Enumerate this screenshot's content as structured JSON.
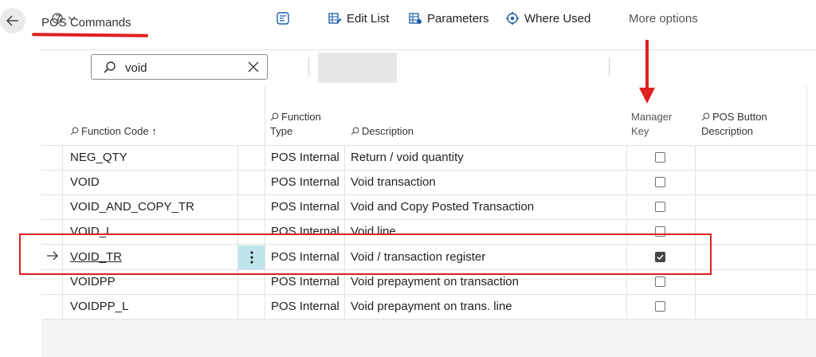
{
  "header": {
    "title": "POS Commands"
  },
  "search": {
    "value": "void"
  },
  "toolbar": {
    "edit_list": "Edit List",
    "parameters": "Parameters",
    "where_used": "Where Used",
    "more_options": "More options"
  },
  "columns": {
    "function_code": "Function Code ↑",
    "function_type_line1": "Function",
    "function_type_line2": "Type",
    "description": "Description",
    "manager_key_line1": "Manager",
    "manager_key_line2": "Key",
    "pos_button_line1": "POS Button",
    "pos_button_line2": "Description"
  },
  "rows": [
    {
      "code": "NEG_QTY",
      "type": "POS Internal",
      "description": "Return / void quantity",
      "manager_key": false
    },
    {
      "code": "VOID",
      "type": "POS Internal",
      "description": "Void transaction",
      "manager_key": false
    },
    {
      "code": "VOID_AND_COPY_TR",
      "type": "POS Internal",
      "description": "Void and Copy Posted Transaction",
      "manager_key": false
    },
    {
      "code": "VOID_L",
      "type": "POS Internal",
      "description": "Void line",
      "manager_key": false
    },
    {
      "code": "VOID_TR",
      "type": "POS Internal",
      "description": "Void / transaction register",
      "manager_key": true,
      "selected": true
    },
    {
      "code": "VOIDPP",
      "type": "POS Internal",
      "description": "Void prepayment on transaction",
      "manager_key": false
    },
    {
      "code": "VOIDPP_L",
      "type": "POS Internal",
      "description": "Void prepayment on trans. line",
      "manager_key": false
    }
  ],
  "colors": {
    "annotation_red": "#e02020",
    "selected_cell": "#bfe6ec"
  }
}
